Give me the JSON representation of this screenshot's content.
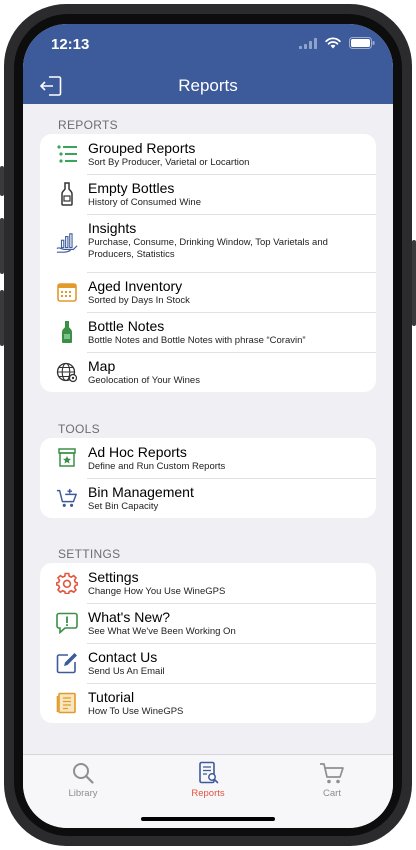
{
  "status": {
    "time": "12:13"
  },
  "header": {
    "title": "Reports"
  },
  "sections": {
    "reports": {
      "label": "REPORTS",
      "items": [
        {
          "title": "Grouped Reports",
          "subtitle": "Sort By Producer, Varietal or Locartion",
          "icon": "list-icon"
        },
        {
          "title": "Empty Bottles",
          "subtitle": "History of Consumed Wine",
          "icon": "empty-bottle-icon"
        },
        {
          "title": "Insights",
          "subtitle": "Purchase, Consume, Drinking Window, Top Varietals and Producers, Statistics",
          "icon": "insights-chart-icon"
        },
        {
          "title": "Aged Inventory",
          "subtitle": "Sorted by Days In Stock",
          "icon": "calendar-icon"
        },
        {
          "title": "Bottle Notes",
          "subtitle": "Bottle Notes and Bottle Notes with phrase “Coravin”",
          "icon": "green-bottle-icon"
        },
        {
          "title": "Map",
          "subtitle": "Geolocation of Your Wines",
          "icon": "globe-icon"
        }
      ]
    },
    "tools": {
      "label": "TOOLS",
      "items": [
        {
          "title": "Ad Hoc Reports",
          "subtitle": "Define and Run Custom Reports",
          "icon": "star-box-icon"
        },
        {
          "title": "Bin Management",
          "subtitle": "Set Bin Capacity",
          "icon": "cart-add-icon"
        }
      ]
    },
    "settings": {
      "label": "SETTINGS",
      "items": [
        {
          "title": "Settings",
          "subtitle": "Change How You Use WineGPS",
          "icon": "gear-icon"
        },
        {
          "title": "What's New?",
          "subtitle": "See What We've Been Working On",
          "icon": "speech-bubble-icon"
        },
        {
          "title": "Contact Us",
          "subtitle": "Send Us An Email",
          "icon": "compose-icon"
        },
        {
          "title": "Tutorial",
          "subtitle": "How To Use WineGPS",
          "icon": "book-icon"
        }
      ]
    }
  },
  "tabs": [
    {
      "label": "Library",
      "icon": "search-icon",
      "active": false
    },
    {
      "label": "Reports",
      "icon": "report-icon",
      "active": true
    },
    {
      "label": "Cart",
      "icon": "cart-icon",
      "active": false
    }
  ],
  "colors": {
    "header": "#3d5a9a",
    "active_tab": "#e2553f",
    "inactive_tab": "#8e8e93",
    "background": "#efeff4"
  }
}
